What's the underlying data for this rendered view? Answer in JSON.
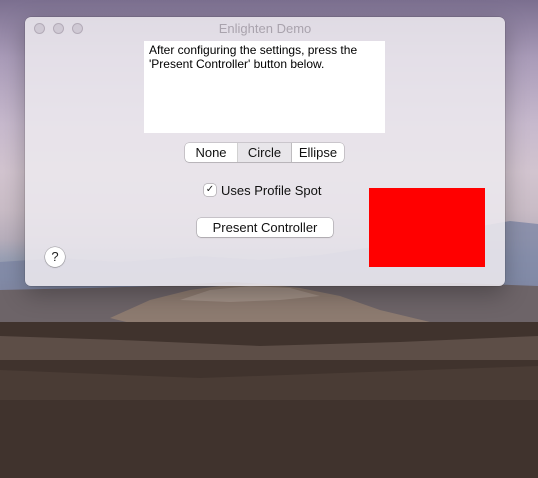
{
  "window": {
    "title": "Enlighten Demo"
  },
  "instructions": {
    "text": "After configuring the settings, press the 'Present Controller' button below."
  },
  "shape_selector": {
    "options": [
      "None",
      "Circle",
      "Ellipse"
    ],
    "selected": "Circle"
  },
  "profile_spot": {
    "checked": true,
    "check_glyph": "✓",
    "label": "Uses Profile Spot"
  },
  "present_button": {
    "label": "Present Controller"
  },
  "help_button": {
    "label": "?"
  },
  "colors": {
    "spot_view": "#ff0000"
  }
}
